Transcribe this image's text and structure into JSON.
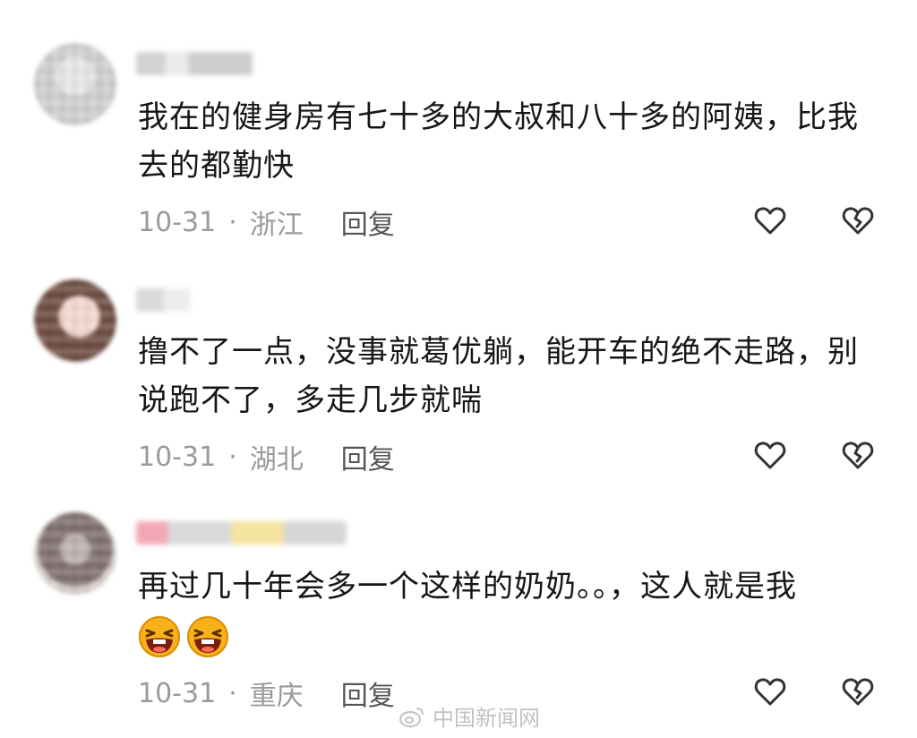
{
  "comments": [
    {
      "username": "",
      "text": "我在的健身房有七十多的大叔和八十多的阿姨，比我去的都勤快",
      "date": "10-31",
      "location": "浙江",
      "reply_label": "回复",
      "like_icon": "heart-outline-icon",
      "dislike_icon": "broken-heart-icon"
    },
    {
      "username": "",
      "text": "撸不了一点，没事就葛优躺，能开车的绝不走路，别说跑不了，多走几步就喘",
      "date": "10-31",
      "location": "湖北",
      "reply_label": "回复",
      "like_icon": "heart-outline-icon",
      "dislike_icon": "broken-heart-icon"
    },
    {
      "username": "",
      "text": "再过几十年会多一个这样的奶奶。。，这人就是我",
      "emojis": [
        "laughing-emoji",
        "laughing-emoji"
      ],
      "date": "10-31",
      "location": "重庆",
      "reply_label": "回复",
      "like_icon": "heart-outline-icon",
      "dislike_icon": "broken-heart-icon"
    }
  ],
  "meta_separator": "·",
  "watermark": {
    "text": "中国新闻网",
    "icon": "weibo-icon"
  },
  "colors": {
    "background": "#ffffff",
    "text": "#161616",
    "meta": "#9a9a9a",
    "reply": "#555555",
    "icon": "#333333"
  }
}
